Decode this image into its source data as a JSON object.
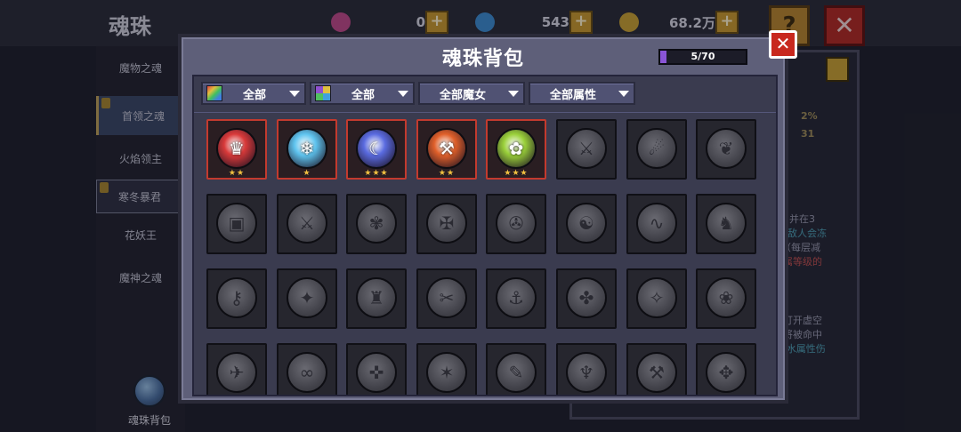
{
  "background": {
    "title": "魂珠",
    "currencies": [
      {
        "icon": "pink-gem-icon",
        "value": "0",
        "color": "#c04a8a"
      },
      {
        "icon": "blue-gem-icon",
        "value": "543",
        "color": "#3c8cd2"
      },
      {
        "icon": "gold-coin-icon",
        "value": "68.2万",
        "color": "#c9a234"
      }
    ],
    "help_label": "?",
    "close_label": "✕",
    "sidebar": [
      {
        "label": "魔物之魂",
        "state": "normal"
      },
      {
        "label": "首领之魂",
        "state": "active",
        "badge": true
      },
      {
        "label": "火焰领主",
        "state": "normal"
      },
      {
        "label": "寒冬暴君",
        "state": "boxed",
        "badge": true
      },
      {
        "label": "花妖王",
        "state": "normal"
      },
      {
        "label": "魔神之魂",
        "state": "normal"
      }
    ],
    "bag_button_label": "魂珠背包",
    "right_panel": {
      "stat_1": "2%",
      "stat_2": "31",
      "desc_lines": [
        "，并在3",
        "中敌人会冻",
        "（每层减",
        "属等级的"
      ],
      "desc_lines_2": [
        "打开虚空",
        "将被命中",
        "/水属性伤"
      ]
    }
  },
  "modal": {
    "title": "魂珠背包",
    "capacity": {
      "text": "5/70",
      "used": 5,
      "total": 70
    },
    "close_label": "✕",
    "filters": [
      {
        "label": "全部",
        "swatch": "rainbow"
      },
      {
        "label": "全部",
        "swatch": "quad"
      },
      {
        "label": "全部魔女",
        "swatch": ""
      },
      {
        "label": "全部属性",
        "swatch": ""
      }
    ],
    "slots": [
      {
        "type": "filled",
        "icon": "fire-demon-orb-icon",
        "glyph": "♛",
        "stars": "★★",
        "color": "#d93a3a"
      },
      {
        "type": "filled",
        "icon": "ice-tyrant-orb-icon",
        "glyph": "❄",
        "stars": "★",
        "color": "#5fc4ef"
      },
      {
        "type": "filled",
        "icon": "wave-orb-icon",
        "glyph": "☾",
        "stars": "★★★",
        "color": "#5a6be0"
      },
      {
        "type": "filled",
        "icon": "flame-hammer-orb-icon",
        "glyph": "⚒",
        "stars": "★★",
        "color": "#e0602a"
      },
      {
        "type": "filled",
        "icon": "flower-orb-icon",
        "glyph": "✿",
        "stars": "★★★",
        "color": "#9ad03a"
      },
      {
        "type": "empty",
        "icon": "axe-silhouette-icon",
        "glyph": "⚔"
      },
      {
        "type": "empty",
        "icon": "claw-silhouette-icon",
        "glyph": "☄"
      },
      {
        "type": "empty",
        "icon": "wing-silhouette-icon",
        "glyph": "❦"
      },
      {
        "type": "empty",
        "icon": "book-silhouette-icon",
        "glyph": "▣"
      },
      {
        "type": "empty",
        "icon": "sword-silhouette-icon",
        "glyph": "⚔"
      },
      {
        "type": "empty",
        "icon": "creature-silhouette-icon",
        "glyph": "✾"
      },
      {
        "type": "empty",
        "icon": "rune-silhouette-icon",
        "glyph": "✠"
      },
      {
        "type": "empty",
        "icon": "pinwheel-silhouette-icon",
        "glyph": "✇"
      },
      {
        "type": "empty",
        "icon": "beast-silhouette-icon",
        "glyph": "☯"
      },
      {
        "type": "empty",
        "icon": "serpent-silhouette-icon",
        "glyph": "∿"
      },
      {
        "type": "empty",
        "icon": "cat-silhouette-icon",
        "glyph": "♞"
      },
      {
        "type": "empty",
        "icon": "key-silhouette-icon",
        "glyph": "⚷"
      },
      {
        "type": "empty",
        "icon": "drill-silhouette-icon",
        "glyph": "✦"
      },
      {
        "type": "empty",
        "icon": "armor-silhouette-icon",
        "glyph": "♜"
      },
      {
        "type": "empty",
        "icon": "dagger-silhouette-icon",
        "glyph": "✂"
      },
      {
        "type": "empty",
        "icon": "fish-silhouette-icon",
        "glyph": "⚓"
      },
      {
        "type": "empty",
        "icon": "clover-silhouette-icon",
        "glyph": "✤"
      },
      {
        "type": "empty",
        "icon": "staff-silhouette-icon",
        "glyph": "✧"
      },
      {
        "type": "empty",
        "icon": "flower-silhouette-icon",
        "glyph": "❀"
      },
      {
        "type": "empty",
        "icon": "bird-silhouette-icon",
        "glyph": "✈"
      },
      {
        "type": "empty",
        "icon": "chain-silhouette-icon",
        "glyph": "∞"
      },
      {
        "type": "empty",
        "icon": "glyph-silhouette-icon",
        "glyph": "✜"
      },
      {
        "type": "empty",
        "icon": "runner-silhouette-icon",
        "glyph": "✶"
      },
      {
        "type": "empty",
        "icon": "scroll-silhouette-icon",
        "glyph": "✎"
      },
      {
        "type": "empty",
        "icon": "horn-silhouette-icon",
        "glyph": "♆"
      },
      {
        "type": "empty",
        "icon": "hammer-silhouette-icon",
        "glyph": "⚒"
      },
      {
        "type": "empty",
        "icon": "mask-silhouette-icon",
        "glyph": "✥"
      }
    ]
  }
}
